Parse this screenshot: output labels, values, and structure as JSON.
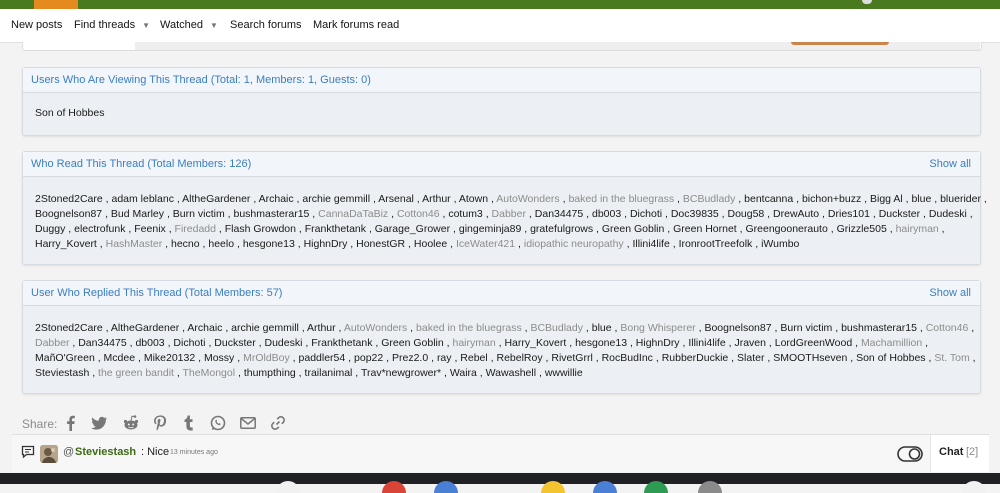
{
  "nav": {
    "new_posts": "New posts",
    "find_threads": "Find threads",
    "watched": "Watched",
    "search_forums": "Search forums",
    "mark_forums_read": "Mark forums read"
  },
  "viewing": {
    "title": "Users Who Are Viewing This Thread (Total: 1, Members: 1, Guests: 0)",
    "members": [
      "Son of Hobbes"
    ]
  },
  "read": {
    "title": "Who Read This Thread (Total Members: 126)",
    "show_all": "Show all",
    "lines": [
      [
        [
          "2Stoned2Care",
          0
        ],
        [
          "adam leblanc",
          0
        ],
        [
          "AltheGardener",
          0
        ],
        [
          "Archaic",
          0
        ],
        [
          "archie gemmill",
          0
        ],
        [
          "Arsenal",
          0
        ],
        [
          "Arthur",
          0
        ],
        [
          "Atown",
          0
        ],
        [
          "AutoWonders",
          1
        ],
        [
          "baked in the bluegrass",
          1
        ],
        [
          "BCBudlady",
          1
        ],
        [
          "bentcanna",
          0
        ],
        [
          "bichon+buzz",
          0
        ],
        [
          "Bigg Al",
          0
        ],
        [
          "blue",
          0
        ],
        [
          "bluerider",
          0
        ]
      ],
      [
        [
          "Boognelson87",
          0
        ],
        [
          "Bud Marley",
          0
        ],
        [
          "Burn victim",
          0
        ],
        [
          "bushmasterar15",
          0
        ],
        [
          "CannaDaTaBiz",
          1
        ],
        [
          "Cotton46",
          1
        ],
        [
          "cotum3",
          0
        ],
        [
          "Dabber",
          1
        ],
        [
          "Dan34475",
          0
        ],
        [
          "db003",
          0
        ],
        [
          "Dichoti",
          0
        ],
        [
          "Doc39835",
          0
        ],
        [
          "Doug58",
          0
        ],
        [
          "DrewAuto",
          0
        ],
        [
          "Dries101",
          0
        ],
        [
          "Duckster",
          0
        ],
        [
          "Dudeski",
          0
        ]
      ],
      [
        [
          "Duggy",
          0
        ],
        [
          "electrofunk",
          0
        ],
        [
          "Feenix",
          0
        ],
        [
          "Firedadd",
          1
        ],
        [
          "Flash Growdon",
          0
        ],
        [
          "Frankthetank",
          0
        ],
        [
          "Garage_Grower",
          0
        ],
        [
          "gingeminja89",
          0
        ],
        [
          "gratefulgrows",
          0
        ],
        [
          "Green Goblin",
          0
        ],
        [
          "Green Hornet",
          0
        ],
        [
          "Greengoonerauto",
          0
        ],
        [
          "Grizzle505",
          0
        ],
        [
          "hairyman",
          1
        ]
      ],
      [
        [
          "Harry_Kovert",
          0
        ],
        [
          "HashMaster",
          1
        ],
        [
          "hecno",
          0
        ],
        [
          "heelo",
          0
        ],
        [
          "hesgone13",
          0
        ],
        [
          "HighnDry",
          0
        ],
        [
          "HonestGR",
          0
        ],
        [
          "Hoolee",
          0
        ],
        [
          "IceWater421",
          1
        ],
        [
          "idiopathic neuropathy",
          1
        ],
        [
          "Illini4life",
          0
        ],
        [
          "IronrootTreefolk",
          0
        ],
        [
          "iWumbo",
          0
        ]
      ]
    ]
  },
  "replied": {
    "title": "User Who Replied This Thread (Total Members: 57)",
    "show_all": "Show all",
    "lines": [
      [
        [
          "2Stoned2Care",
          0
        ],
        [
          "AltheGardener",
          0
        ],
        [
          "Archaic",
          0
        ],
        [
          "archie gemmill",
          0
        ],
        [
          "Arthur",
          0
        ],
        [
          "AutoWonders",
          1
        ],
        [
          "baked in the bluegrass",
          1
        ],
        [
          "BCBudlady",
          1
        ],
        [
          "blue",
          0
        ],
        [
          "Bong Whisperer",
          1
        ],
        [
          "Boognelson87",
          0
        ],
        [
          "Burn victim",
          0
        ],
        [
          "bushmasterar15",
          0
        ],
        [
          "Cotton46",
          1
        ]
      ],
      [
        [
          "Dabber",
          1
        ],
        [
          "Dan34475",
          0
        ],
        [
          "db003",
          0
        ],
        [
          "Dichoti",
          0
        ],
        [
          "Duckster",
          0
        ],
        [
          "Dudeski",
          0
        ],
        [
          "Frankthetank",
          0
        ],
        [
          "Green Goblin",
          0
        ],
        [
          "hairyman",
          1
        ],
        [
          "Harry_Kovert",
          0
        ],
        [
          "hesgone13",
          0
        ],
        [
          "HighnDry",
          0
        ],
        [
          "Illini4life",
          0
        ],
        [
          "Jraven",
          0
        ],
        [
          "LordGreenWood",
          0
        ],
        [
          "Machamillion",
          1
        ]
      ],
      [
        [
          "MañO'Green",
          0
        ],
        [
          "Mcdee",
          0
        ],
        [
          "Mike20132",
          0
        ],
        [
          "Mossy",
          0
        ],
        [
          "MrOldBoy",
          1
        ],
        [
          "paddler54",
          0
        ],
        [
          "pop22",
          0
        ],
        [
          "Prez2.0",
          0
        ],
        [
          "ray",
          0
        ],
        [
          "Rebel",
          0
        ],
        [
          "RebelRoy",
          0
        ],
        [
          "RivetGrrl",
          0
        ],
        [
          "RocBudInc",
          0
        ],
        [
          "RubberDuckie",
          0
        ],
        [
          "Slater",
          0
        ],
        [
          "SMOOTHseven",
          0
        ],
        [
          "Son of Hobbes",
          0
        ],
        [
          "St. Tom",
          1
        ]
      ],
      [
        [
          "Steviestash",
          0
        ],
        [
          "the green bandit",
          1
        ],
        [
          "TheMongol",
          1
        ],
        [
          "thumpthing",
          0
        ],
        [
          "trailanimal",
          0
        ],
        [
          "Trav*newgrower*",
          0
        ],
        [
          "Waira",
          0
        ],
        [
          "Wawashell",
          0
        ],
        [
          "wwwillie",
          0
        ]
      ]
    ]
  },
  "share": {
    "label": "Share:",
    "icons": [
      "facebook-icon",
      "twitter-icon",
      "reddit-icon",
      "pinterest-icon",
      "tumblr-icon",
      "whatsapp-icon",
      "email-icon",
      "link-icon"
    ]
  },
  "chat": {
    "at": "@",
    "user": "Steviestash",
    "message": ": Nice",
    "time": "13 minutes ago",
    "chat_label": "Chat",
    "chat_count": "[2]"
  },
  "colors": {
    "link": "#3a7ebf",
    "muted_user": "#8c8c8c",
    "top_bar": "#4a7a1f",
    "accent": "#e48a1e"
  }
}
